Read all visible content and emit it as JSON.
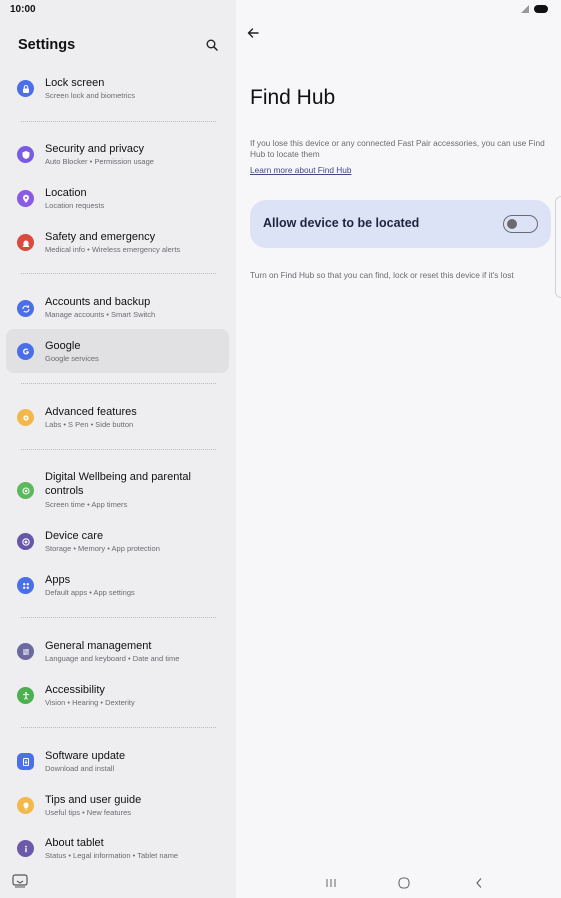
{
  "status_bar": {
    "time": "10:00"
  },
  "sidebar": {
    "title": "Settings",
    "items": [
      {
        "title": "Lock screen",
        "subtitle": "Screen lock and biometrics",
        "icon": "lock-icon",
        "color": "#4a6fe8"
      },
      {
        "title": "Security and privacy",
        "subtitle": "Auto Blocker  •  Permission usage",
        "icon": "shield-icon",
        "color": "#7b5be6"
      },
      {
        "title": "Location",
        "subtitle": "Location requests",
        "icon": "location-pin-icon",
        "color": "#8a5be6"
      },
      {
        "title": "Safety and emergency",
        "subtitle": "Medical info  •  Wireless emergency alerts",
        "icon": "siren-icon",
        "color": "#d84b3f"
      },
      {
        "title": "Accounts and backup",
        "subtitle": "Manage accounts  •  Smart Switch",
        "icon": "sync-icon",
        "color": "#4a6fe8"
      },
      {
        "title": "Google",
        "subtitle": "Google services",
        "icon": "google-icon",
        "color": "#4a6fe8"
      },
      {
        "title": "Advanced features",
        "subtitle": "Labs  •  S Pen  •  Side button",
        "icon": "gear-star-icon",
        "color": "#f2b84b"
      },
      {
        "title": "Digital Wellbeing and parental controls",
        "subtitle": "Screen time  •  App timers",
        "icon": "wellbeing-icon",
        "color": "#5cb85c"
      },
      {
        "title": "Device care",
        "subtitle": "Storage  •  Memory  •  App protection",
        "icon": "device-care-icon",
        "color": "#6657a8"
      },
      {
        "title": "Apps",
        "subtitle": "Default apps  •  App settings",
        "icon": "apps-grid-icon",
        "color": "#4a6fe8"
      },
      {
        "title": "General management",
        "subtitle": "Language and keyboard  •  Date and time",
        "icon": "sliders-icon",
        "color": "#6a6aa0"
      },
      {
        "title": "Accessibility",
        "subtitle": "Vision  •  Hearing  •  Dexterity",
        "icon": "accessibility-icon",
        "color": "#4caf50"
      },
      {
        "title": "Software update",
        "subtitle": "Download and install",
        "icon": "software-update-icon",
        "color": "#4a6fe8"
      },
      {
        "title": "Tips and user guide",
        "subtitle": "Useful tips  •  New features",
        "icon": "lightbulb-icon",
        "color": "#f2b84b"
      },
      {
        "title": "About tablet",
        "subtitle": "Status  •  Legal information  •  Tablet name",
        "icon": "info-icon",
        "color": "#6a5aa8"
      }
    ]
  },
  "detail": {
    "title": "Find Hub",
    "description": "If you lose this device or any connected Fast Pair accessories, you can use Find Hub to locate them",
    "link": "Learn more about Find Hub",
    "toggle_label": "Allow device to be located",
    "toggle_state": "off",
    "helper": "Turn on Find Hub so that you can find, lock or reset this device if it's lost"
  }
}
